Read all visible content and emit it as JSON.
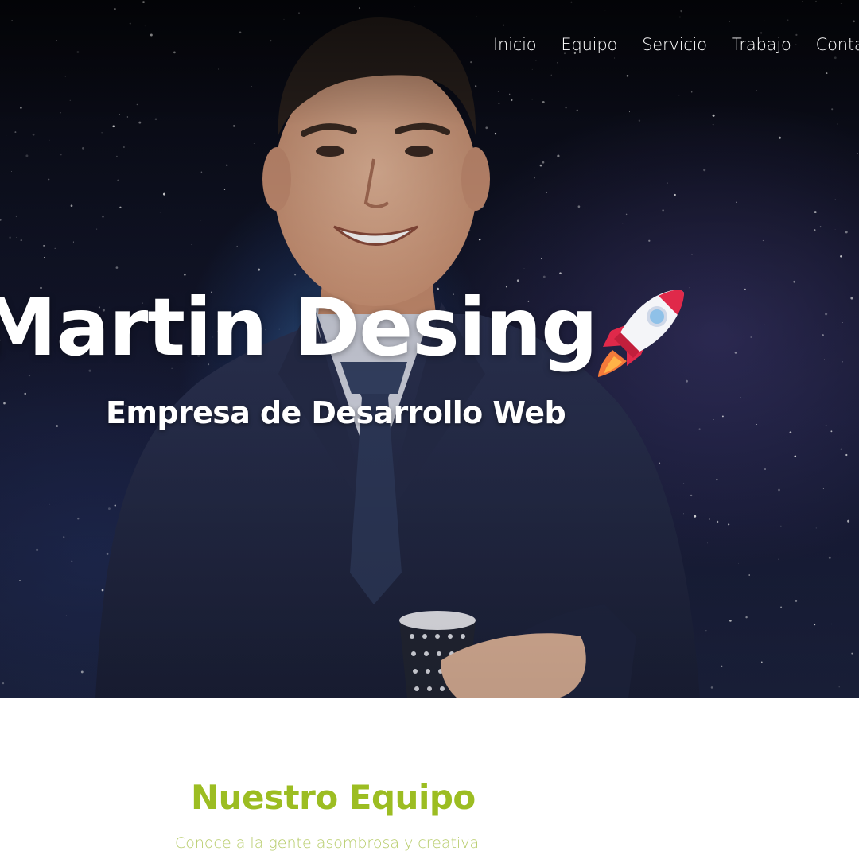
{
  "nav": {
    "items": [
      "Inicio",
      "Equipo",
      "Servicio",
      "Trabajo",
      "Contacto"
    ]
  },
  "hero": {
    "title": "Martin Desing",
    "subtitle": "Empresa de Desarrollo Web",
    "icon": "rocket-icon"
  },
  "team": {
    "heading": "Nuestro Equipo",
    "subheading": "Conoce a la gente asombrosa y creativa"
  },
  "colors": {
    "accent_green": "#9cbd22",
    "hero_text": "#ffffff",
    "rocket_red": "#e0294a"
  }
}
